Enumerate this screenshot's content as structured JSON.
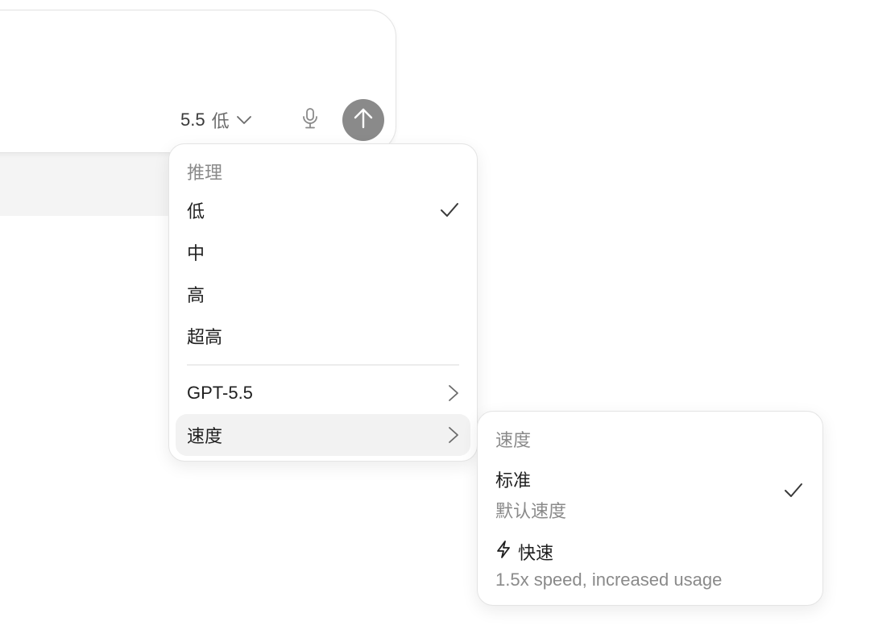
{
  "composer": {
    "model_version": "5.5",
    "model_effort": "低",
    "mic_icon": "microphone-icon",
    "send_icon": "arrow-up-icon"
  },
  "reasoning_menu": {
    "header": "推理",
    "options": [
      {
        "label": "低",
        "selected": true
      },
      {
        "label": "中",
        "selected": false
      },
      {
        "label": "高",
        "selected": false
      },
      {
        "label": "超高",
        "selected": false
      }
    ],
    "model_item": "GPT-5.5",
    "speed_item": "速度"
  },
  "speed_menu": {
    "header": "速度",
    "standard_title": "标准",
    "standard_desc": "默认速度",
    "standard_selected": true,
    "fast_title": "快速",
    "fast_icon": "lightning-icon",
    "fast_desc": "1.5x speed, increased usage"
  },
  "colors": {
    "send_button": "#8a8a8a",
    "highlight": "#f2f2f2",
    "muted_text": "#8a8a8a"
  }
}
